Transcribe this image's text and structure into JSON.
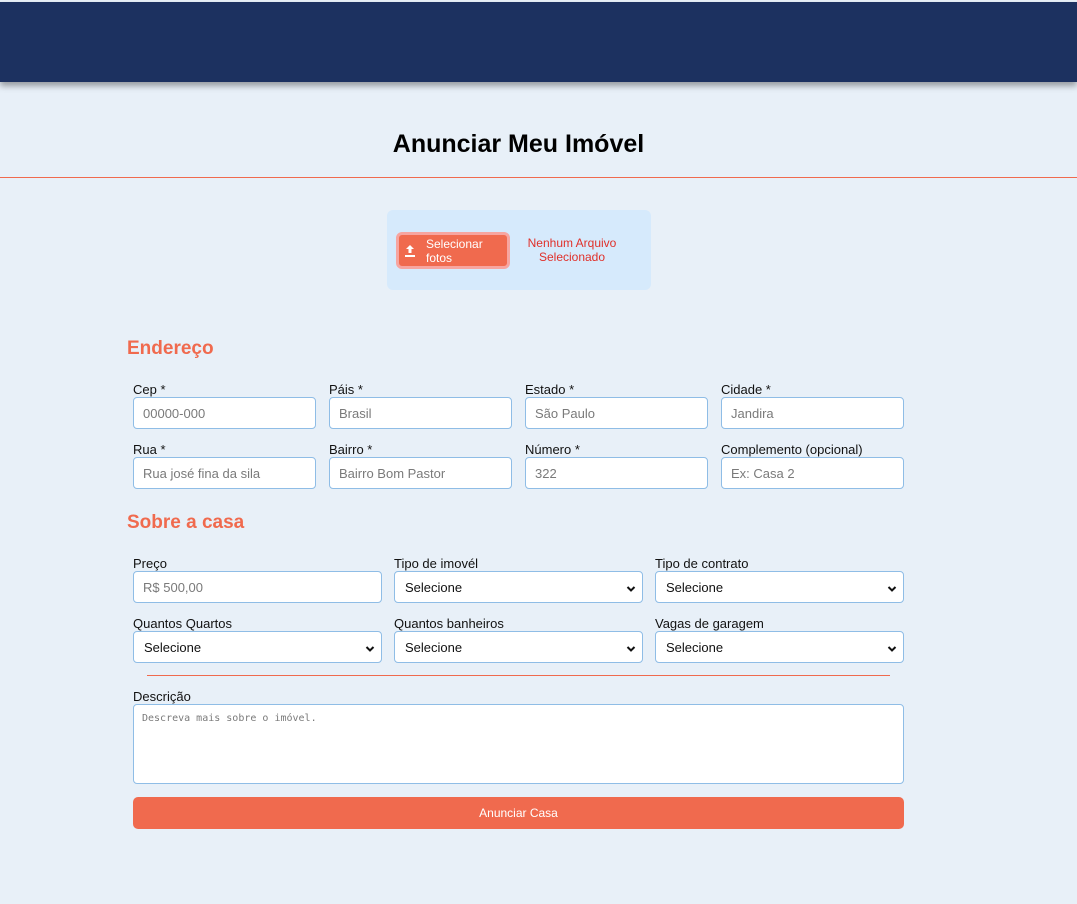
{
  "page": {
    "title": "Anunciar Meu Imóvel"
  },
  "upload": {
    "button_label": "Selecionar fotos",
    "status": "Nenhum Arquivo Selecionado"
  },
  "address": {
    "section_title": "Endereço",
    "cep": {
      "label": "Cep *",
      "placeholder": "00000-000"
    },
    "pais": {
      "label": "Páis *",
      "placeholder": "Brasil"
    },
    "estado": {
      "label": "Estado *",
      "placeholder": "São Paulo"
    },
    "cidade": {
      "label": "Cidade *",
      "placeholder": "Jandira"
    },
    "rua": {
      "label": "Rua *",
      "placeholder": "Rua josé fina da sila"
    },
    "bairro": {
      "label": "Bairro *",
      "placeholder": "Bairro Bom Pastor"
    },
    "numero": {
      "label": "Número *",
      "placeholder": "322"
    },
    "complemento": {
      "label": "Complemento (opcional)",
      "placeholder": "Ex: Casa 2"
    }
  },
  "house": {
    "section_title": "Sobre a casa",
    "preco": {
      "label": "Preço",
      "placeholder": "R$ 500,00"
    },
    "tipo_imovel": {
      "label": "Tipo de imovél",
      "value": "Selecione"
    },
    "tipo_contrato": {
      "label": "Tipo de contrato",
      "value": "Selecione"
    },
    "quartos": {
      "label": "Quantos Quartos",
      "value": "Selecione"
    },
    "banheiros": {
      "label": "Quantos banheiros",
      "value": "Selecione"
    },
    "vagas": {
      "label": "Vagas de garagem",
      "value": "Selecione"
    }
  },
  "description": {
    "label": "Descrição",
    "placeholder": "Descreva mais sobre o imóvel."
  },
  "submit": {
    "label": "Anunciar Casa"
  },
  "colors": {
    "header": "#1c3160",
    "accent": "#f06a4e",
    "background": "#e8f0f8",
    "upload_panel": "#d6eafc"
  },
  "icons": {
    "upload": "upload-icon",
    "select_chevron": "chevron-down-icon"
  }
}
